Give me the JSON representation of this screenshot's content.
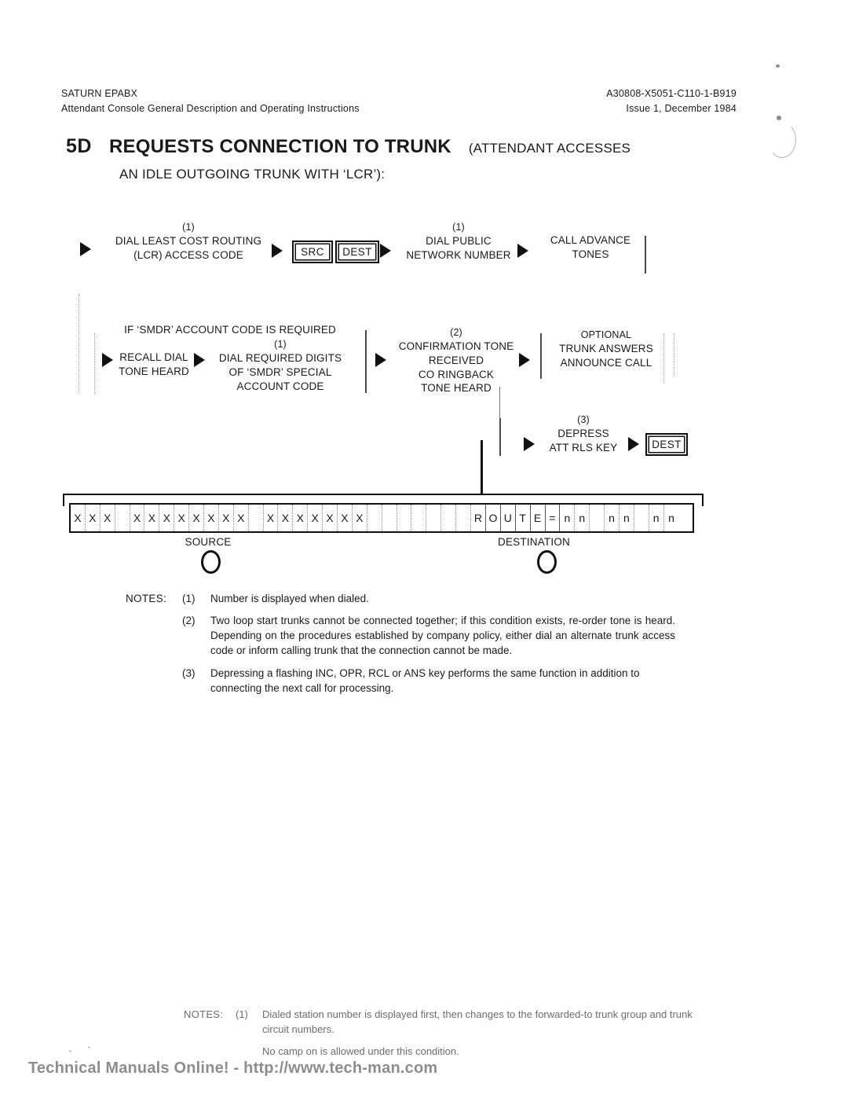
{
  "header": {
    "left_line1": "SATURN EPABX",
    "left_line2": "Attendant Console General Description and Operating Instructions",
    "right_line1": "A30808-X5051-C110-1-B919",
    "right_line2": "Issue 1, December 1984"
  },
  "title": {
    "number": "5D",
    "main": "REQUESTS CONNECTION TO TRUNK",
    "paren": "(ATTENDANT ACCESSES",
    "line2": "AN IDLE OUTGOING TRUNK WITH ‘LCR’):"
  },
  "diagram": {
    "row1": {
      "step1_sup": "(1)",
      "step1_l1": "DIAL LEAST COST ROUTING",
      "step1_l2": "(LCR) ACCESS CODE",
      "key_src": "SRC",
      "key_dest": "DEST",
      "step2_sup": "(1)",
      "step2_l1": "DIAL PUBLIC",
      "step2_l2": "NETWORK NUMBER",
      "step3_l1": "CALL ADVANCE",
      "step3_l2": "TONES"
    },
    "row2": {
      "condition": "IF ‘SMDR’ ACCOUNT CODE IS REQUIRED",
      "step1_l1": "RECALL DIAL",
      "step1_l2": "TONE HEARD",
      "step2_sup": "(1)",
      "step2_l1": "DIAL REQUIRED DIGITS",
      "step2_l2": "OF ‘SMDR’ SPECIAL",
      "step2_l3": "ACCOUNT CODE",
      "step3_sup": "(2)",
      "step3_l1": "CONFIRMATION TONE",
      "step3_l2": "RECEIVED",
      "step3_l3": "CO RINGBACK",
      "step3_l4": "TONE HEARD",
      "step4_sup": "OPTIONAL",
      "step4_l1": "TRUNK ANSWERS",
      "step4_l2": "ANNOUNCE CALL"
    },
    "row3": {
      "step1_sup": "(3)",
      "step1_l1": "DEPRESS",
      "step1_l2": "ATT RLS KEY",
      "key_dest": "DEST"
    },
    "display": {
      "cells": [
        "X",
        "X",
        "X",
        "",
        "X",
        "X",
        "X",
        "X",
        "X",
        "X",
        "X",
        "X",
        "",
        "X",
        "X",
        "X",
        "X",
        "X",
        "X",
        "X",
        "",
        "",
        "",
        "",
        "",
        "",
        "",
        "R",
        "O",
        "U",
        "T",
        "E",
        "=",
        "n",
        "n",
        "",
        "n",
        "n",
        "",
        "n",
        "n"
      ],
      "source_label": "SOURCE",
      "destination_label": "DESTINATION"
    }
  },
  "notes": {
    "label": "NOTES:",
    "items": [
      {
        "num": "(1)",
        "text": "Number is displayed when dialed."
      },
      {
        "num": "(2)",
        "text": "Two loop start trunks cannot be connected together; if this condition exists, re-order tone is heard. Depending on the procedures established by company policy, either dial an alternate trunk access code or inform calling trunk that the connection cannot be made."
      },
      {
        "num": "(3)",
        "text": "Depressing a flashing INC, OPR, RCL or ANS key performs the same function in addition to connecting the next call for processing."
      }
    ]
  },
  "notes_faded": {
    "label": "NOTES:",
    "num": "(1)",
    "text": "Dialed station number is displayed first, then changes to the forwarded-to trunk group and trunk circuit numbers.",
    "text2": "No camp on is allowed under this condition."
  },
  "footer": {
    "text": "Technical Manuals Online! - http://www.tech-man.com"
  }
}
